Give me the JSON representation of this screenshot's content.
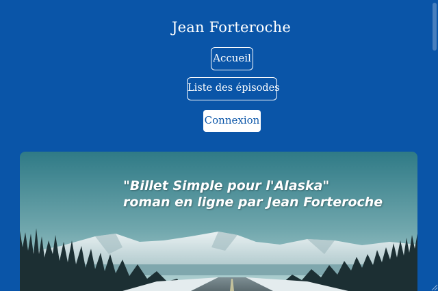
{
  "site": {
    "title": "Jean Forteroche"
  },
  "nav": {
    "accueil": "Accueil",
    "episodes": "Liste des épisodes",
    "connexion": "Connexion"
  },
  "hero": {
    "line1": "\"Billet Simple pour l'Alaska\"",
    "line2": "roman en ligne par Jean Forteroche"
  },
  "colors": {
    "background": "#0a55a8",
    "button_text_active": "#0a55a8",
    "white": "#ffffff"
  }
}
